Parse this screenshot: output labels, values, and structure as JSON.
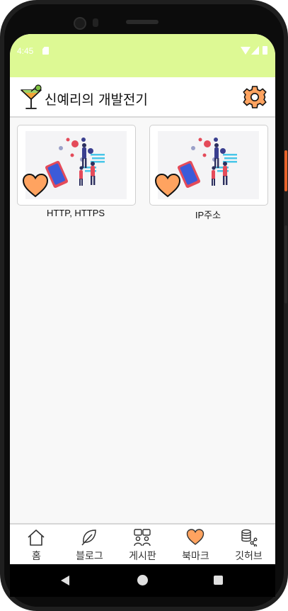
{
  "status_bar": {
    "time": "4:45",
    "icons": [
      "sd-card-icon",
      "wifi-icon",
      "signal-icon",
      "battery-icon"
    ]
  },
  "header": {
    "title": "신예리의 개발전기",
    "logo_icon": "cocktail-icon",
    "settings_icon": "gear-icon"
  },
  "posts": [
    {
      "title": "HTTP, HTTPS",
      "bookmarked": true
    },
    {
      "title": "IP주소",
      "bookmarked": true
    }
  ],
  "bottom_nav": {
    "items": [
      {
        "label": "홈",
        "icon": "home-icon"
      },
      {
        "label": "블로그",
        "icon": "leaf-icon"
      },
      {
        "label": "게시판",
        "icon": "chat-people-icon"
      },
      {
        "label": "북마크",
        "icon": "heart-icon"
      },
      {
        "label": "깃허브",
        "icon": "database-share-icon"
      }
    ],
    "active": "북마크"
  },
  "colors": {
    "status_bar": "#ddf994",
    "heart": "#ffa360",
    "gear": "#ffa360",
    "background": "#f8f8f8"
  }
}
